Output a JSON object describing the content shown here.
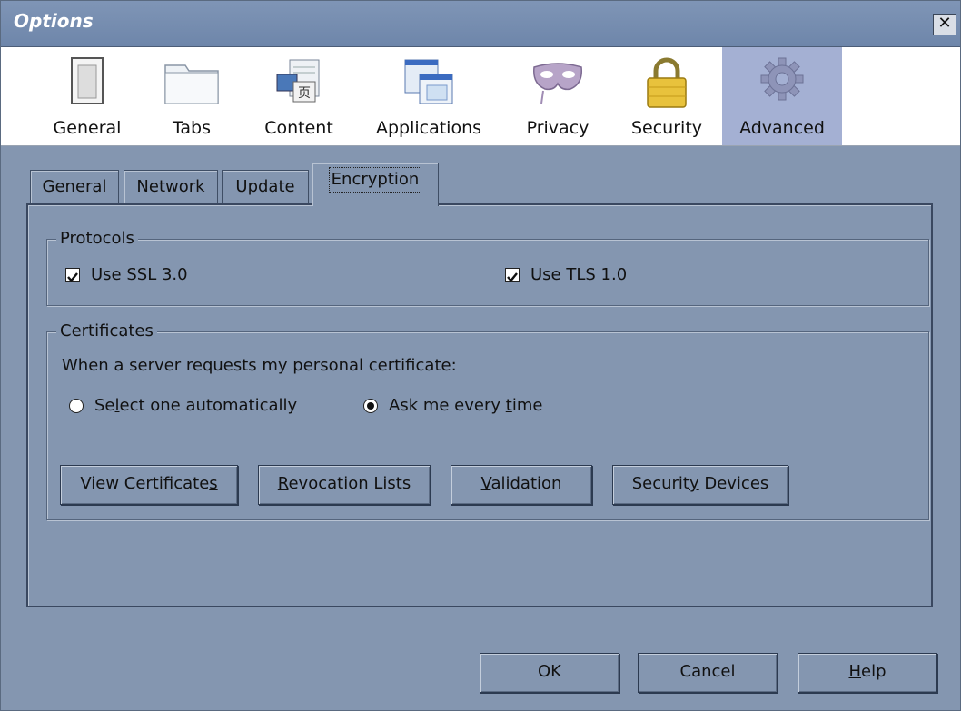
{
  "window": {
    "title": "Options",
    "close_label": "✕"
  },
  "toolbar": {
    "items": [
      {
        "label": "General",
        "icon": "general-window-icon"
      },
      {
        "label": "Tabs",
        "icon": "tabs-folder-icon"
      },
      {
        "label": "Content",
        "icon": "content-page-icon"
      },
      {
        "label": "Applications",
        "icon": "applications-icon"
      },
      {
        "label": "Privacy",
        "icon": "privacy-mask-icon"
      },
      {
        "label": "Security",
        "icon": "security-lock-icon"
      },
      {
        "label": "Advanced",
        "icon": "advanced-gear-icon",
        "selected": true
      }
    ]
  },
  "subtabs": {
    "items": [
      "General",
      "Network",
      "Update",
      "Encryption"
    ],
    "active": "Encryption"
  },
  "protocols": {
    "legend": "Protocols",
    "ssl": {
      "label_pre": "Use SSL ",
      "label_accel": "3",
      "label_post": ".0",
      "checked": true
    },
    "tls": {
      "label_pre": "Use TLS ",
      "label_accel": "1",
      "label_post": ".0",
      "checked": true
    }
  },
  "certificates": {
    "legend": "Certificates",
    "prompt": "When a server requests my personal certificate:",
    "radio_auto": {
      "pre": "Se",
      "accel": "l",
      "post": "ect one automatically",
      "selected": false
    },
    "radio_ask": {
      "pre": "Ask me every ",
      "accel": "t",
      "post": "ime",
      "selected": true
    },
    "buttons": {
      "view": {
        "pre": "View Certificate",
        "accel": "s",
        "post": ""
      },
      "revocation": {
        "pre": "",
        "accel": "R",
        "post": "evocation Lists"
      },
      "validation": {
        "pre": "",
        "accel": "V",
        "post": "alidation"
      },
      "devices": {
        "pre": "Securit",
        "accel": "y",
        "post": " Devices"
      }
    }
  },
  "footer": {
    "ok": "OK",
    "cancel": "Cancel",
    "help_accel": "H",
    "help_post": "elp"
  },
  "colors": {
    "dialog_bg": "#8496b0",
    "selected_toolbar": "#a4b0d3",
    "titlebar": "#7389ad"
  }
}
